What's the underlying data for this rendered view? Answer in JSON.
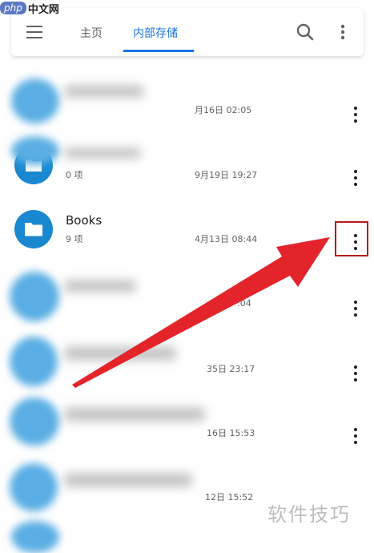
{
  "watermark": {
    "brand_latin": "php",
    "brand_cn": "中文网",
    "footer": "软件技巧"
  },
  "appbar": {
    "tabs": [
      {
        "label": "主页"
      },
      {
        "label": "内部存储",
        "active": true
      }
    ],
    "icons": [
      "menu-icon",
      "search-icon",
      "more-vert-icon"
    ],
    "accent_color": "#1a73e8"
  },
  "list": {
    "items": [
      {
        "title": "",
        "subtitle": "",
        "date": "月16日 02:05",
        "blurred": true
      },
      {
        "title": "",
        "subtitle": "0 项",
        "date": "9月19日 19:27",
        "blurred": true
      },
      {
        "title": "Books",
        "subtitle": "9 项",
        "date": "4月13日 08:44",
        "blurred": false,
        "highlighted_menu": true
      },
      {
        "title": "",
        "subtitle": "",
        "date": ":04",
        "blurred": true
      },
      {
        "title": "",
        "subtitle": "",
        "date": "35日 23:17",
        "blurred": true
      },
      {
        "title": "",
        "subtitle": "",
        "date": "16日 15:53",
        "blurred": true
      },
      {
        "title": "",
        "subtitle": "",
        "date": "12日 15:52",
        "blurred": true
      }
    ],
    "folder_color": "#1a88d0"
  },
  "annotation": {
    "arrow_color": "#e3242b",
    "box_color": "#b41c1c"
  }
}
